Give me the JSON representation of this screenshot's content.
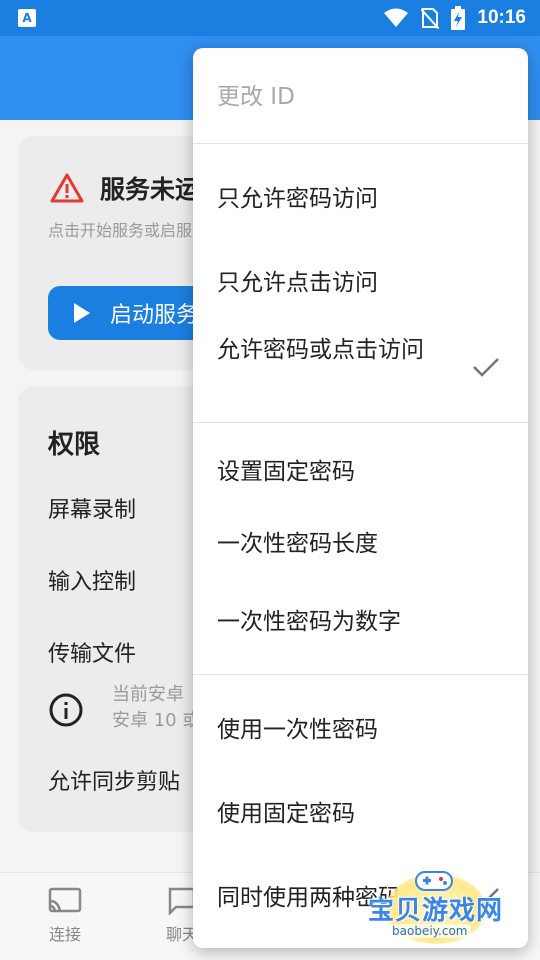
{
  "status_bar": {
    "app_badge": "A",
    "time": "10:16"
  },
  "service_card": {
    "title": "服务未运",
    "description": "点击开始服务或启服务",
    "start_label": "启动服务"
  },
  "permissions": {
    "title": "权限",
    "items": [
      "屏幕录制",
      "输入控制",
      "传输文件"
    ],
    "info_line1": "当前安卓",
    "info_line2": "安卓 10 或",
    "clipboard": "允许同步剪贴"
  },
  "bottom_nav": {
    "connect": "连接",
    "chat": "聊天"
  },
  "menu": {
    "change_id": "更改 ID",
    "password_only": "只允许密码访问",
    "click_only": "只允许点击访问",
    "password_or_click": "允许密码或点击访问",
    "set_fixed_password": "设置固定密码",
    "otp_length": "一次性密码长度",
    "otp_numeric": "一次性密码为数字",
    "use_otp": "使用一次性密码",
    "use_fixed": "使用固定密码",
    "use_both": "同时使用两种密码"
  },
  "watermark": {
    "title": "宝贝游戏网",
    "url": "baobeiy.com"
  },
  "colors": {
    "primary": "#1a7fe0",
    "appbar": "#2f8ff0",
    "warning": "#e53935"
  }
}
